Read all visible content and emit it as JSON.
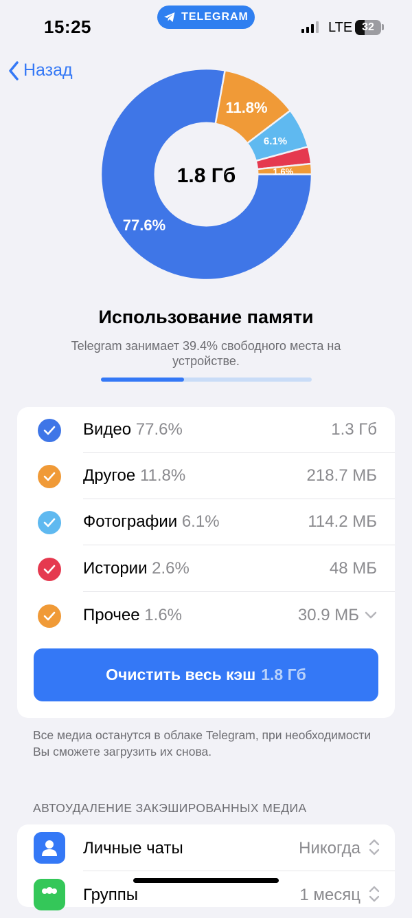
{
  "status_bar": {
    "time": "15:25",
    "app_pill": "TELEGRAM",
    "network": "LTE",
    "battery": "32"
  },
  "nav": {
    "back_label": "Назад"
  },
  "chart_data": {
    "type": "pie",
    "center_label": "1.8 Гб",
    "slices": [
      {
        "name": "Видео",
        "value": 77.6,
        "label": "77.6%",
        "color": "#3f76e7"
      },
      {
        "name": "Другое",
        "value": 11.8,
        "label": "11.8%",
        "color": "#f09a37"
      },
      {
        "name": "Фотографии",
        "value": 6.1,
        "label": "6.1%",
        "color": "#5fb9f0"
      },
      {
        "name": "Истории",
        "value": 2.6,
        "label": "",
        "color": "#e5394f"
      },
      {
        "name": "Прочее",
        "value": 1.6,
        "label": "1.6%",
        "color": "#f09a37"
      }
    ]
  },
  "storage": {
    "title": "Использование памяти",
    "subtitle": "Telegram занимает 39.4% свободного места на устройстве.",
    "usage_fraction": 0.394
  },
  "categories": [
    {
      "name": "Видео",
      "percent": "77.6%",
      "size": "1.3 Гб",
      "color": "#3f76e7",
      "checked": true
    },
    {
      "name": "Другое",
      "percent": "11.8%",
      "size": "218.7 МБ",
      "color": "#f09a37",
      "checked": true
    },
    {
      "name": "Фотографии",
      "percent": "6.1%",
      "size": "114.2 МБ",
      "color": "#5fb9f0",
      "checked": true
    },
    {
      "name": "Истории",
      "percent": "2.6%",
      "size": "48 МБ",
      "color": "#e5394f",
      "checked": true
    },
    {
      "name": "Прочее",
      "percent": "1.6%",
      "size": "30.9 МБ",
      "color": "#f09a37",
      "checked": true
    }
  ],
  "clear_button": {
    "label": "Очистить весь кэш",
    "amount": "1.8 Гб"
  },
  "info_text": "Все медиа останутся в облаке Telegram, при необходимости Вы сможете загрузить их снова.",
  "auto_delete": {
    "header": "АВТОУДАЛЕНИЕ ЗАКЭШИРОВАННЫХ МЕДИА",
    "rows": [
      {
        "name": "Личные чаты",
        "value": "Никогда",
        "icon": "person-icon",
        "color": "#3478f6"
      },
      {
        "name": "Группы",
        "value": "1 месяц",
        "icon": "group-icon",
        "color": "#34c759"
      }
    ]
  }
}
